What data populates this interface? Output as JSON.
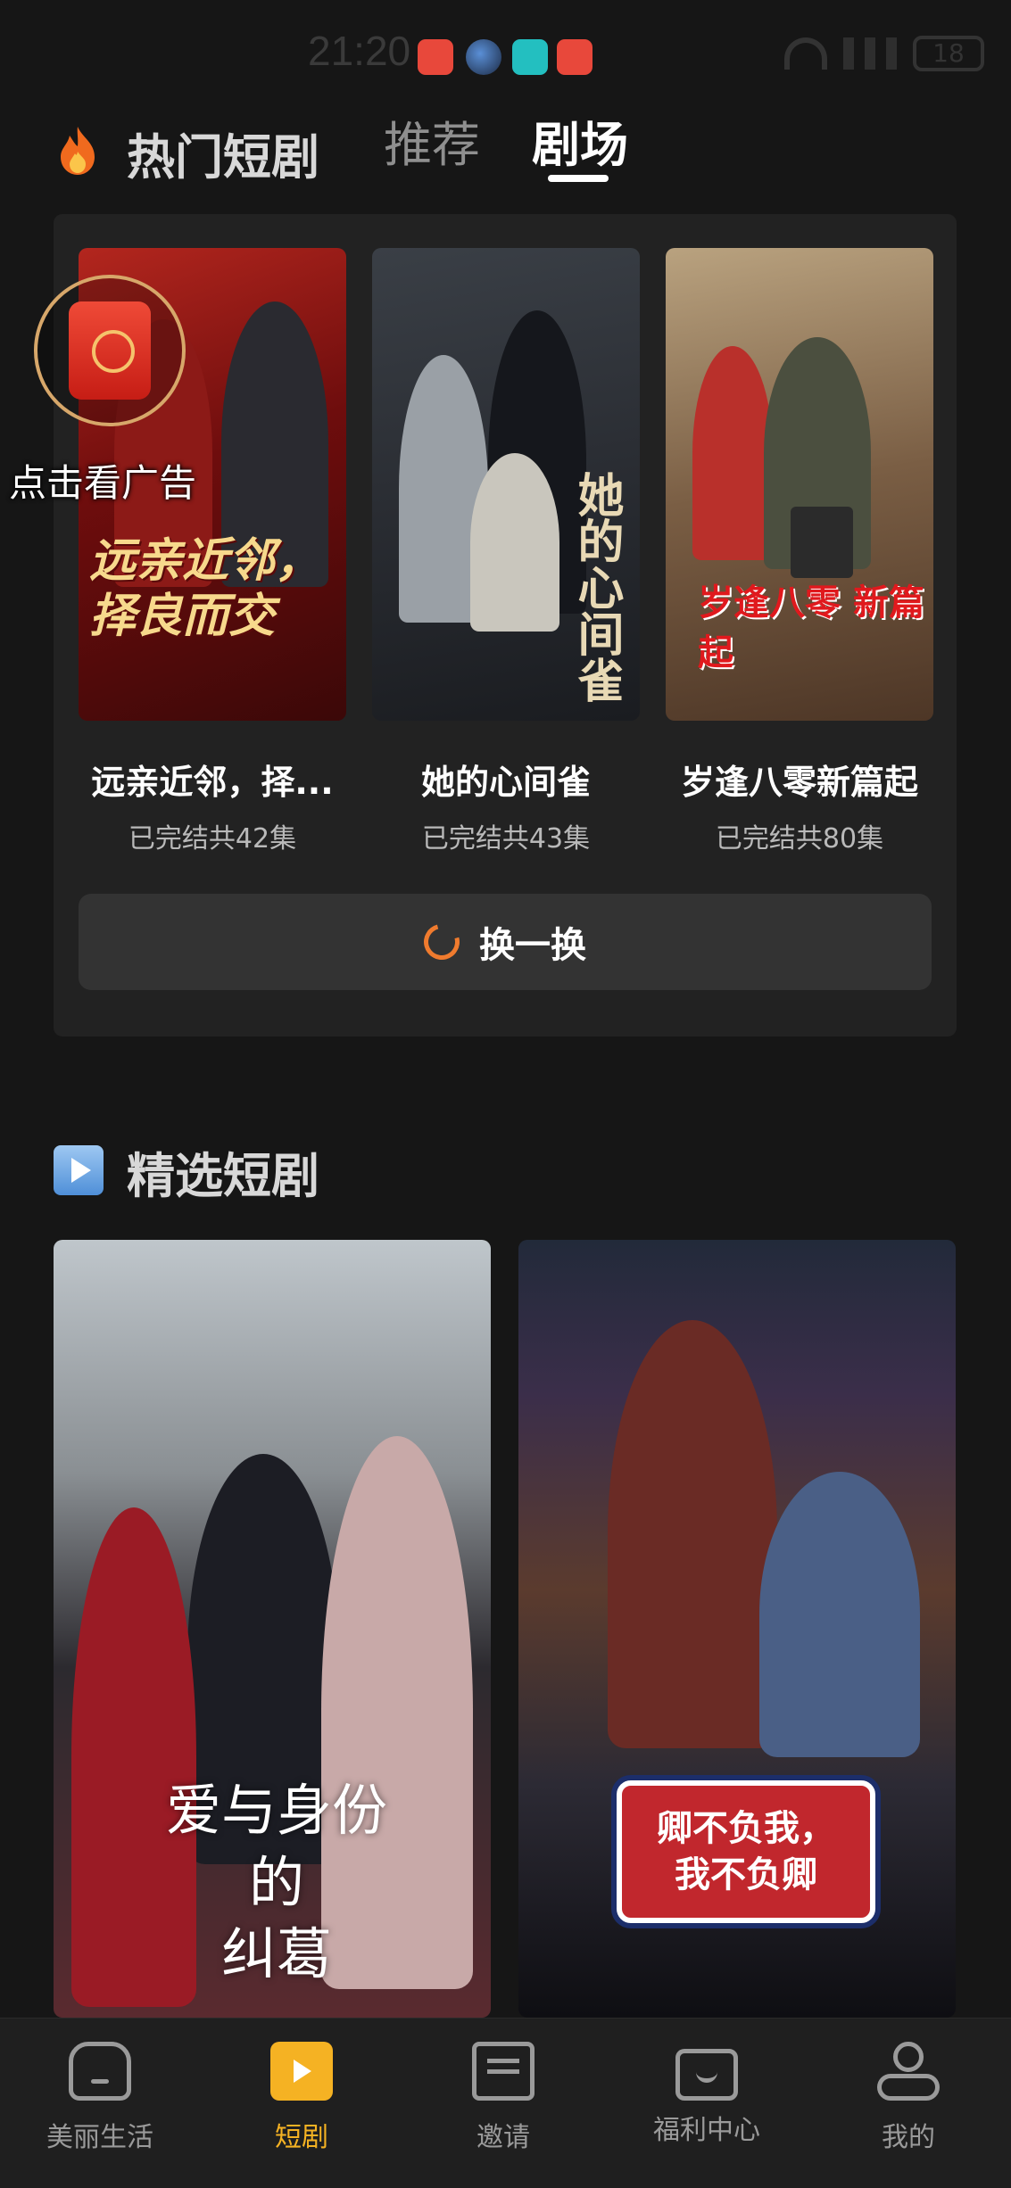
{
  "status_bar": {
    "time": "21:20",
    "battery": "18"
  },
  "header": {
    "title": "热门短剧",
    "tabs": [
      {
        "label": "推荐",
        "active": false
      },
      {
        "label": "剧场",
        "active": true
      }
    ]
  },
  "ad": {
    "label": "点击看广告"
  },
  "hot_dramas": [
    {
      "title": "远亲近邻，择...",
      "status": "已完结共42集",
      "poster_text": "远亲近邻，择良而交"
    },
    {
      "title": "她的心间雀",
      "status": "已完结共43集",
      "poster_text": "她的心间雀"
    },
    {
      "title": "岁逢八零新篇起",
      "status": "已完结共80集",
      "poster_text": "岁逢八零 新篇起"
    }
  ],
  "refresh_label": "换一换",
  "featured": {
    "title": "精选短剧",
    "cards": [
      {
        "poster_text_lines": [
          "爱与身份",
          "的",
          "纠葛"
        ]
      },
      {
        "poster_text_lines": [
          "卿不负我，",
          "我不负卿"
        ]
      }
    ]
  },
  "bottom_nav": [
    {
      "label": "美丽生活",
      "icon": "home-icon",
      "active": false
    },
    {
      "label": "短剧",
      "icon": "play-icon",
      "active": true
    },
    {
      "label": "邀请",
      "icon": "mail-icon",
      "active": false
    },
    {
      "label": "福利中心",
      "icon": "gift-icon",
      "active": false
    },
    {
      "label": "我的",
      "icon": "user-icon",
      "active": false
    }
  ],
  "colors": {
    "accent": "#f5b223",
    "refresh_icon": "#f07b2e",
    "background": "#161616"
  }
}
